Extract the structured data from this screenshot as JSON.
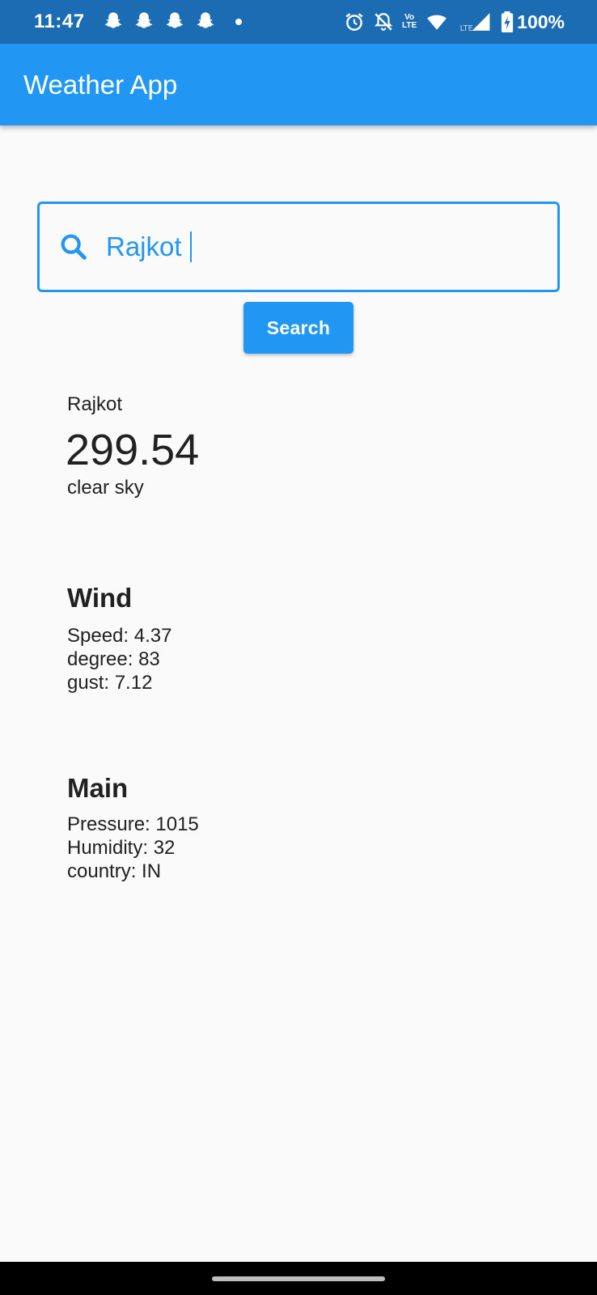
{
  "status_bar": {
    "time": "11:47",
    "battery": "100%",
    "volte_top": "Vo",
    "volte_bottom": "LTE",
    "icons": [
      "snapchat-icon",
      "snapchat-icon",
      "snapchat-icon",
      "snapchat-icon",
      "dot-icon",
      "alarm-icon",
      "bell-off-icon",
      "volte-icon",
      "wifi-icon",
      "signal-icon",
      "battery-icon"
    ]
  },
  "app_bar": {
    "title": "Weather App"
  },
  "search": {
    "value": "Rajkot",
    "icon": "search-icon",
    "button_label": "Search"
  },
  "weather": {
    "city": "Rajkot",
    "temperature": "299.54",
    "condition": "clear sky"
  },
  "wind": {
    "title": "Wind",
    "speed": "Speed: 4.37",
    "degree": "degree: 83",
    "gust": "gust: 7.12"
  },
  "main": {
    "title": "Main",
    "pressure": "Pressure: 1015",
    "humidity": "Humidity: 32",
    "country": "country: IN"
  },
  "colors": {
    "primary": "#2196f3",
    "status_bar": "#1c6cb3",
    "background": "#fafafa"
  }
}
